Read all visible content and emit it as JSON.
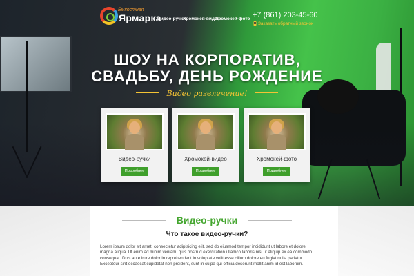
{
  "header": {
    "logo_top": "Ёмкостная",
    "logo_main": "Ярмарка",
    "nav": [
      "Видео-ручки",
      "Хромокей-видео",
      "Хромокей-фото"
    ],
    "phone": "+7 (861) 203-45-60",
    "callback": "Заказать обратный звонок"
  },
  "hero": {
    "title_line1": "ШОУ НА КОРПОРАТИВ,",
    "title_line2": "СВАДЬБУ, ДЕНЬ РОЖДЕНИЕ",
    "subtitle": "Видео развлечение!"
  },
  "cards": [
    {
      "title": "Видео-ручки",
      "button": "Подробнее"
    },
    {
      "title": "Хромокей-видео",
      "button": "Подробнее"
    },
    {
      "title": "Хромокей-фото",
      "button": "Подробнее"
    }
  ],
  "section": {
    "title": "Видео-ручки",
    "subtitle": "Что такое видео-ручки?",
    "paragraph": "Lorem ipsum dolor sit amet, consectetur adipisicing elit, sed do eiusmod tempor incididunt ut labore et dolore magna aliqua. Ut enim ad minim veniam, quis nostrud exercitation ullamco laboris nisi ut aliquip ex ea commodo consequat. Duis aute irure dolor in reprehenderit in voluptate velit esse cillum dolore eu fugiat nulla pariatur. Excepteur sint occaecat cupidatat non proident, sunt in culpa qui officia deserunt mollit anim id est laborum."
  },
  "colors": {
    "accent_green": "#3f9f2b",
    "accent_yellow": "#f3c334",
    "section_title": "#45a630"
  },
  "icons": {
    "logo": "colorful-ring-logo",
    "callback": "phone-icon"
  }
}
